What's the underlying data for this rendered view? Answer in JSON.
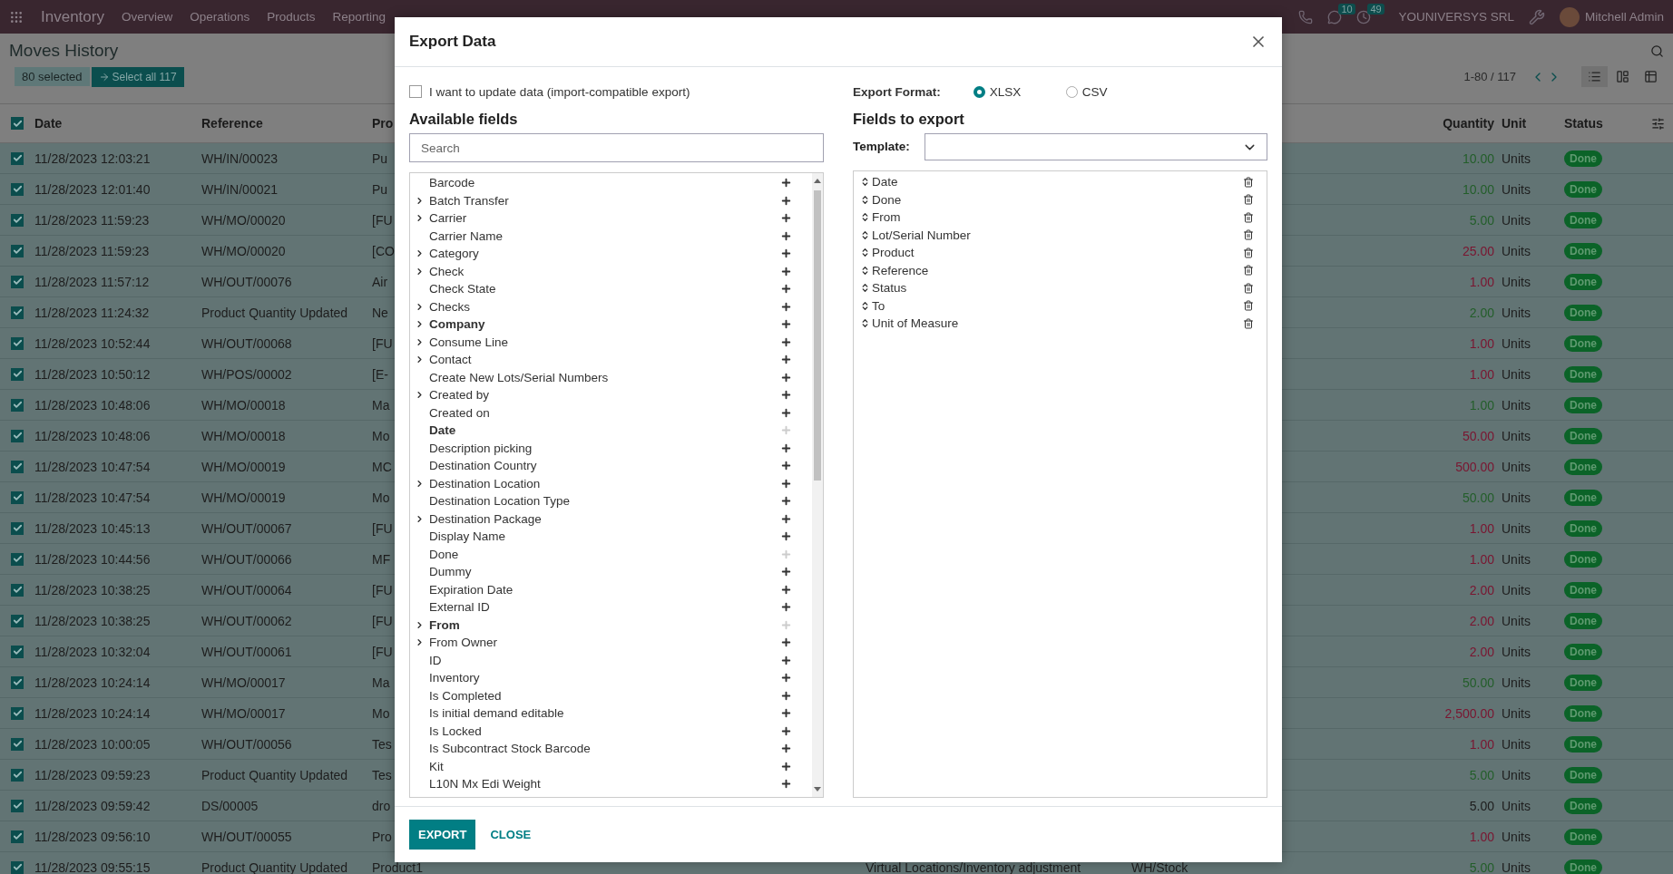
{
  "navbar": {
    "app": "Inventory",
    "menus": [
      "Overview",
      "Operations",
      "Products",
      "Reporting"
    ],
    "badges": [
      {
        "kind": "chat",
        "count": "10"
      },
      {
        "kind": "clock",
        "count": "49"
      }
    ],
    "company": "YOUNIVERSYS SRL",
    "user": "Mitchell Admin"
  },
  "control_panel": {
    "title": "Moves History",
    "selected_count": "80 selected",
    "select_all": "Select all 117",
    "pager": "1-80 / 117",
    "views": [
      {
        "kind": "list",
        "selected": true
      },
      {
        "kind": "kanban",
        "selected": false
      },
      {
        "kind": "pivot",
        "selected": false
      }
    ]
  },
  "table": {
    "all_checked": true,
    "columns": [
      "Date",
      "Reference",
      "Pro",
      "Quantity",
      "Unit",
      "Status"
    ],
    "rows": [
      {
        "selected": true,
        "date": "11/28/2023 12:03:21",
        "reference": "WH/IN/00023",
        "product": "Pu",
        "quantity": "10.00",
        "kind": "in",
        "unit": "Units",
        "status": "Done"
      },
      {
        "selected": true,
        "date": "11/28/2023 12:01:40",
        "reference": "WH/IN/00021",
        "product": "Pu",
        "quantity": "10.00",
        "kind": "in",
        "unit": "Units",
        "status": "Done"
      },
      {
        "selected": true,
        "date": "11/28/2023 11:59:23",
        "reference": "WH/MO/00020",
        "product": "[FU",
        "quantity": "5.00",
        "kind": "in",
        "unit": "Units",
        "status": "Done"
      },
      {
        "selected": true,
        "date": "11/28/2023 11:59:23",
        "reference": "WH/MO/00020",
        "product": "[CO",
        "quantity": "25.00",
        "kind": "out",
        "unit": "Units",
        "status": "Done"
      },
      {
        "selected": true,
        "date": "11/28/2023 11:57:12",
        "reference": "WH/OUT/00076",
        "product": "Air",
        "quantity": "1.00",
        "kind": "out",
        "unit": "Units",
        "status": "Done"
      },
      {
        "selected": true,
        "date": "11/28/2023 11:24:32",
        "reference": "Product Quantity Updated",
        "product": "Ne",
        "quantity": "2.00",
        "kind": "in",
        "unit": "Units",
        "status": "Done"
      },
      {
        "selected": true,
        "date": "11/28/2023 10:52:44",
        "reference": "WH/OUT/00068",
        "product": "[FU",
        "quantity": "1.00",
        "kind": "out",
        "unit": "Units",
        "status": "Done"
      },
      {
        "selected": true,
        "date": "11/28/2023 10:50:12",
        "reference": "WH/POS/00002",
        "product": "[E-",
        "quantity": "1.00",
        "kind": "out",
        "unit": "Units",
        "status": "Done"
      },
      {
        "selected": true,
        "date": "11/28/2023 10:48:06",
        "reference": "WH/MO/00018",
        "product": "Ma",
        "quantity": "1.00",
        "kind": "in",
        "unit": "Units",
        "status": "Done"
      },
      {
        "selected": true,
        "date": "11/28/2023 10:48:06",
        "reference": "WH/MO/00018",
        "product": "Mo",
        "quantity": "50.00",
        "kind": "out",
        "unit": "Units",
        "status": "Done"
      },
      {
        "selected": true,
        "date": "11/28/2023 10:47:54",
        "reference": "WH/MO/00019",
        "product": "MC",
        "quantity": "500.00",
        "kind": "out",
        "unit": "Units",
        "status": "Done"
      },
      {
        "selected": true,
        "date": "11/28/2023 10:47:54",
        "reference": "WH/MO/00019",
        "product": "Mo",
        "quantity": "50.00",
        "kind": "in",
        "unit": "Units",
        "status": "Done"
      },
      {
        "selected": true,
        "date": "11/28/2023 10:45:13",
        "reference": "WH/OUT/00067",
        "product": "[FU",
        "quantity": "1.00",
        "kind": "out",
        "unit": "Units",
        "status": "Done"
      },
      {
        "selected": true,
        "date": "11/28/2023 10:44:56",
        "reference": "WH/OUT/00066",
        "product": "MF",
        "quantity": "1.00",
        "kind": "out",
        "unit": "Units",
        "status": "Done"
      },
      {
        "selected": true,
        "date": "11/28/2023 10:38:25",
        "reference": "WH/OUT/00064",
        "product": "[FU",
        "quantity": "2.00",
        "kind": "out",
        "unit": "Units",
        "status": "Done"
      },
      {
        "selected": true,
        "date": "11/28/2023 10:38:25",
        "reference": "WH/OUT/00062",
        "product": "[FU",
        "quantity": "2.00",
        "kind": "out",
        "unit": "Units",
        "status": "Done"
      },
      {
        "selected": true,
        "date": "11/28/2023 10:32:04",
        "reference": "WH/OUT/00061",
        "product": "[FU",
        "quantity": "2.00",
        "kind": "out",
        "unit": "Units",
        "status": "Done"
      },
      {
        "selected": true,
        "date": "11/28/2023 10:24:14",
        "reference": "WH/MO/00017",
        "product": "Ma",
        "quantity": "50.00",
        "kind": "in",
        "unit": "Units",
        "status": "Done"
      },
      {
        "selected": true,
        "date": "11/28/2023 10:24:14",
        "reference": "WH/MO/00017",
        "product": "Mo",
        "quantity": "2,500.00",
        "kind": "out",
        "unit": "Units",
        "status": "Done"
      },
      {
        "selected": true,
        "date": "11/28/2023 10:00:05",
        "reference": "WH/OUT/00056",
        "product": "Tes",
        "quantity": "1.00",
        "kind": "out",
        "unit": "Units",
        "status": "Done"
      },
      {
        "selected": true,
        "date": "11/28/2023 09:59:23",
        "reference": "Product Quantity Updated",
        "product": "Tes",
        "quantity": "5.00",
        "kind": "in",
        "unit": "Units",
        "status": "Done"
      },
      {
        "selected": true,
        "date": "11/28/2023 09:59:42",
        "reference": "DS/00005",
        "product": "dro",
        "quantity": "5.00",
        "kind": "internal",
        "unit": "Units",
        "status": "Done"
      },
      {
        "selected": true,
        "date": "11/28/2023 09:56:10",
        "reference": "WH/OUT/00055",
        "product": "Pro",
        "quantity": "1.00",
        "kind": "out",
        "unit": "Units",
        "status": "Done"
      },
      {
        "selected": true,
        "date": "11/28/2023 09:55:15",
        "reference": "Product Quantity Updated",
        "product": "Product1",
        "from": "Virtual Locations/Inventory adjustment",
        "to": "WH/Stock",
        "quantity": "5.00",
        "kind": "in",
        "unit": "Units",
        "status": "Done"
      }
    ]
  },
  "dialog": {
    "title": "Export Data",
    "import_compatible": {
      "label": "I want to update data (import-compatible export)",
      "checked": false
    },
    "format_label": "Export Format:",
    "formats": [
      {
        "label": "XLSX",
        "selected": true
      },
      {
        "label": "CSV",
        "selected": false
      }
    ],
    "available_title": "Available fields",
    "search": {
      "placeholder": "Search"
    },
    "available_fields": [
      {
        "label": "Barcode",
        "expandable": false,
        "required": false,
        "added": false
      },
      {
        "label": "Batch Transfer",
        "expandable": true,
        "required": false,
        "added": false
      },
      {
        "label": "Carrier",
        "expandable": true,
        "required": false,
        "added": false
      },
      {
        "label": "Carrier Name",
        "expandable": false,
        "required": false,
        "added": false
      },
      {
        "label": "Category",
        "expandable": true,
        "required": false,
        "added": false
      },
      {
        "label": "Check",
        "expandable": true,
        "required": false,
        "added": false
      },
      {
        "label": "Check State",
        "expandable": false,
        "required": false,
        "added": false
      },
      {
        "label": "Checks",
        "expandable": true,
        "required": false,
        "added": false
      },
      {
        "label": "Company",
        "expandable": true,
        "required": true,
        "added": false
      },
      {
        "label": "Consume Line",
        "expandable": true,
        "required": false,
        "added": false
      },
      {
        "label": "Contact",
        "expandable": true,
        "required": false,
        "added": false
      },
      {
        "label": "Create New Lots/Serial Numbers",
        "expandable": false,
        "required": false,
        "added": false
      },
      {
        "label": "Created by",
        "expandable": true,
        "required": false,
        "added": false
      },
      {
        "label": "Created on",
        "expandable": false,
        "required": false,
        "added": false
      },
      {
        "label": "Date",
        "expandable": false,
        "required": true,
        "added": true
      },
      {
        "label": "Description picking",
        "expandable": false,
        "required": false,
        "added": false
      },
      {
        "label": "Destination Country",
        "expandable": false,
        "required": false,
        "added": false
      },
      {
        "label": "Destination Location",
        "expandable": true,
        "required": false,
        "added": false
      },
      {
        "label": "Destination Location Type",
        "expandable": false,
        "required": false,
        "added": false
      },
      {
        "label": "Destination Package",
        "expandable": true,
        "required": false,
        "added": false
      },
      {
        "label": "Display Name",
        "expandable": false,
        "required": false,
        "added": false
      },
      {
        "label": "Done",
        "expandable": false,
        "required": false,
        "added": true
      },
      {
        "label": "Dummy",
        "expandable": false,
        "required": false,
        "added": false
      },
      {
        "label": "Expiration Date",
        "expandable": false,
        "required": false,
        "added": false
      },
      {
        "label": "External ID",
        "expandable": false,
        "required": false,
        "added": false
      },
      {
        "label": "From",
        "expandable": true,
        "required": true,
        "added": true
      },
      {
        "label": "From Owner",
        "expandable": true,
        "required": false,
        "added": false
      },
      {
        "label": "ID",
        "expandable": false,
        "required": false,
        "added": false
      },
      {
        "label": "Inventory",
        "expandable": false,
        "required": false,
        "added": false
      },
      {
        "label": "Is Completed",
        "expandable": false,
        "required": false,
        "added": false
      },
      {
        "label": "Is initial demand editable",
        "expandable": false,
        "required": false,
        "added": false
      },
      {
        "label": "Is Locked",
        "expandable": false,
        "required": false,
        "added": false
      },
      {
        "label": "Is Subcontract Stock Barcode",
        "expandable": false,
        "required": false,
        "added": false
      },
      {
        "label": "Kit",
        "expandable": false,
        "required": false,
        "added": false
      },
      {
        "label": "L10N Mx Edi Weight",
        "expandable": false,
        "required": false,
        "added": false
      }
    ],
    "export_title": "Fields to export",
    "template_label": "Template:",
    "export_fields": [
      "Date",
      "Done",
      "From",
      "Lot/Serial Number",
      "Product",
      "Reference",
      "Status",
      "To",
      "Unit of Measure"
    ],
    "buttons": [
      {
        "kind": "primary",
        "label": "EXPORT"
      },
      {
        "kind": "link",
        "label": "CLOSE"
      }
    ]
  }
}
